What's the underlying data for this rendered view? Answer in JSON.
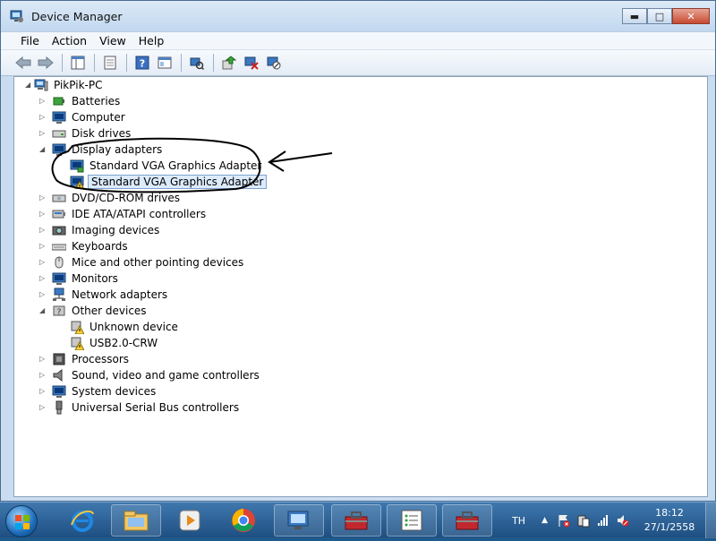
{
  "window": {
    "title": "Device Manager",
    "minimize_icon": "minimize-icon",
    "maximize_icon": "maximize-icon",
    "close_icon": "close-icon"
  },
  "menu": {
    "file": "File",
    "action": "Action",
    "view": "View",
    "help": "Help"
  },
  "toolbar": {
    "icons": [
      "back-arrow-icon",
      "forward-arrow-icon",
      "show-hide-tree-icon",
      "properties-icon",
      "help-icon",
      "console-view-icon",
      "scan-hardware-icon",
      "update-driver-icon",
      "uninstall-icon",
      "disable-device-icon"
    ]
  },
  "tree": {
    "root": "PikPik-PC",
    "categories": {
      "batteries": "Batteries",
      "computer": "Computer",
      "disk_drives": "Disk drives",
      "display_adapters": "Display adapters",
      "dvd": "DVD/CD-ROM drives",
      "ide": "IDE ATA/ATAPI controllers",
      "imaging": "Imaging devices",
      "keyboards": "Keyboards",
      "mice": "Mice and other pointing devices",
      "monitors": "Monitors",
      "network": "Network adapters",
      "other": "Other devices",
      "processors": "Processors",
      "sound": "Sound, video and game controllers",
      "system": "System devices",
      "usb": "Universal Serial Bus controllers"
    },
    "display_children": [
      "Standard VGA Graphics Adapter",
      "Standard VGA Graphics Adapter"
    ],
    "other_children": [
      "Unknown device",
      "USB2.0-CRW"
    ]
  },
  "taskbar": {
    "language": "TH",
    "time": "18:12",
    "date": "27/1/2558",
    "apps": [
      "internet-explorer-icon",
      "file-explorer-icon",
      "media-player-icon",
      "chrome-icon",
      "device-manager-icon",
      "toolbox-icon",
      "task-list-icon",
      "toolbox-icon"
    ]
  }
}
